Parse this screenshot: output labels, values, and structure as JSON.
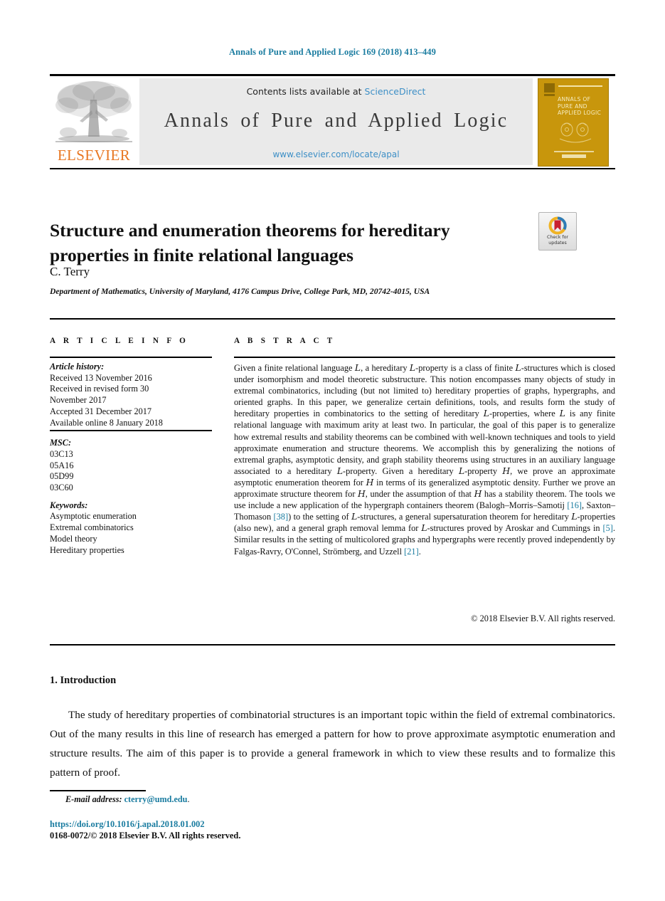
{
  "running_head": "Annals of Pure and Applied Logic 169 (2018) 413–449",
  "masthead": {
    "contents_prefix": "Contents lists available at ",
    "sciencedirect": "ScienceDirect",
    "journal_title": "Annals of Pure and Applied Logic",
    "journal_url": "www.elsevier.com/locate/apal",
    "publisher_wordmark": "ELSEVIER",
    "cover_title": "ANNALS OF PURE AND APPLIED LOGIC",
    "link_color": "#3d8fc6",
    "cover_color": "#c8960c",
    "wordmark_color": "#e87722"
  },
  "article": {
    "title": "Structure and enumeration theorems for hereditary properties in finite relational languages",
    "author": "C. Terry",
    "affiliation": "Department of Mathematics, University of Maryland, 4176 Campus Drive, College Park, MD, 20742-4015, USA",
    "crossmark_label_line1": "Check for",
    "crossmark_label_line2": "updates"
  },
  "info": {
    "heading": "A R T I C L E   I N F O",
    "history_label": "Article history:",
    "history": [
      "Received 13 November 2016",
      "Received in revised form 30",
      "November 2017",
      "Accepted 31 December 2017",
      "Available online 8 January 2018"
    ],
    "msc_label": "MSC:",
    "msc": [
      "03C13",
      "05A16",
      "05D99",
      "03C60"
    ],
    "keywords_label": "Keywords:",
    "keywords": [
      "Asymptotic enumeration",
      "Extremal combinatorics",
      "Model theory",
      "Hereditary properties"
    ]
  },
  "abstract": {
    "heading": "A B S T R A C T",
    "paragraph_html": "Given a finite relational language <span class=\"cal\">L</span>, a hereditary <span class=\"cal\">L</span>-property is a class of finite <span class=\"cal\">L</span>-structures which is closed under isomorphism and model theoretic substructure. This notion encompasses many objects of study in extremal combinatorics, including (but not limited to) hereditary properties of graphs, hypergraphs, and oriented graphs. In this paper, we generalize certain definitions, tools, and results form the study of hereditary properties in combinatorics to the setting of hereditary <span class=\"cal\">L</span>-properties, where <span class=\"cal\">L</span> is any finite relational language with maximum arity at least two. In particular, the goal of this paper is to generalize how extremal results and stability theorems can be combined with well-known techniques and tools to yield approximate enumeration and structure theorems. We accomplish this by generalizing the notions of extremal graphs, asymptotic density, and graph stability theorems using structures in an auxiliary language associated to a hereditary <span class=\"cal\">L</span>-property. Given a hereditary <span class=\"cal\">L</span>-property <span class=\"cal\">H</span>, we prove an approximate asymptotic enumeration theorem for <span class=\"cal\">H</span> in terms of its generalized asymptotic density. Further we prove an approximate structure theorem for <span class=\"cal\">H</span>, under the assumption of that <span class=\"cal\">H</span> has a stability theorem. The tools we use include a new application of the hypergraph containers theorem (Balogh–Morris–Samotij <span class=\"ref\">[16]</span>, Saxton–Thomason <span class=\"ref\">[38]</span>) to the setting of <span class=\"cal\">L</span>-structures, a general supersaturation theorem for hereditary <span class=\"cal\">L</span>-properties (also new), and a general graph removal lemma for <span class=\"cal\">L</span>-structures proved by Aroskar and Cummings in <span class=\"ref\">[5]</span>. Similar results in the setting of multicolored graphs and hypergraphs were recently proved independently by Falgas-Ravry, O'Connel, Strömberg, and Uzzell <span class=\"ref\">[21]</span>.",
    "citations": [
      "[16]",
      "[38]",
      "[5]",
      "[21]"
    ],
    "copyright": "© 2018 Elsevier B.V. All rights reserved."
  },
  "introduction": {
    "section_number_title": "1.  Introduction",
    "paragraph": "The study of hereditary properties of combinatorial structures is an important topic within the field of extremal combinatorics. Out of the many results in this line of research has emerged a pattern for how to prove approximate asymptotic enumeration and structure results. The aim of this paper is to provide a general framework in which to view these results and to formalize this pattern of proof."
  },
  "footer": {
    "email_label": "E-mail address:",
    "email": "cterry@umd.edu",
    "email_suffix": ".",
    "doi": "https://doi.org/10.1016/j.apal.2018.01.002",
    "issn_line": "0168-0072/© 2018 Elsevier B.V. All rights reserved."
  }
}
